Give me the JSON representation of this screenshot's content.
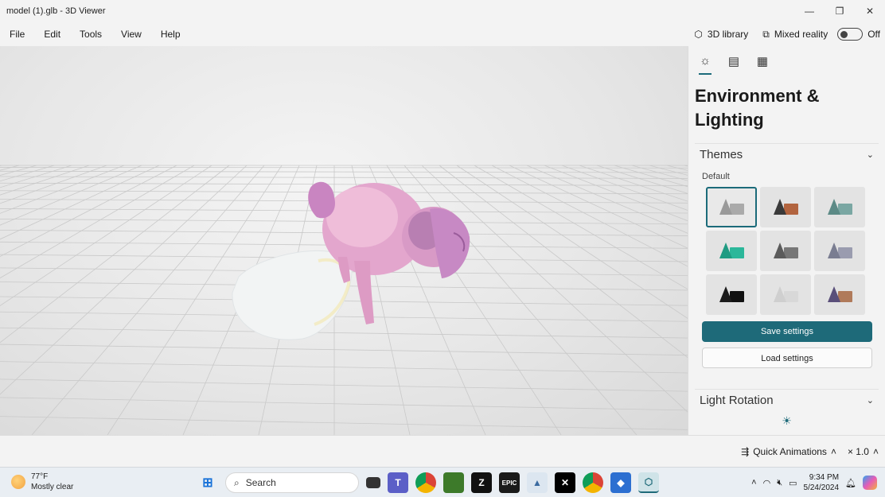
{
  "window": {
    "title": "model (1).glb - 3D Viewer"
  },
  "menu": {
    "items": [
      "File",
      "Edit",
      "Tools",
      "View",
      "Help"
    ],
    "library_label": "3D library",
    "mixed_reality_label": "Mixed reality",
    "mixed_reality_state": "Off"
  },
  "panel": {
    "title_line1": "Environment &",
    "title_line2": "Lighting",
    "themes_label": "Themes",
    "themes_sub": "Default",
    "save_label": "Save settings",
    "load_label": "Load settings",
    "light_rotation_label": "Light Rotation",
    "theme_colors": [
      {
        "cone": "#9a9a9a",
        "box": "#aaaaaa"
      },
      {
        "cone": "#3a3a3a",
        "box": "#b2643f"
      },
      {
        "cone": "#5c8a86",
        "box": "#7aa7a3"
      },
      {
        "cone": "#1f9b82",
        "box": "#2bb79a"
      },
      {
        "cone": "#5b5b5b",
        "box": "#777777"
      },
      {
        "cone": "#7a7d91",
        "box": "#9a9caf"
      },
      {
        "cone": "#1c1c1c",
        "box": "#111111"
      },
      {
        "cone": "#cfcfcf",
        "box": "#d8d8d8"
      },
      {
        "cone": "#5a4f7a",
        "box": "#b07a5a"
      }
    ]
  },
  "bottom": {
    "quick_animations": "Quick Animations",
    "speed": "× 1.0"
  },
  "taskbar": {
    "temperature": "77°F",
    "condition": "Mostly clear",
    "search_placeholder": "Search",
    "time": "9:34 PM",
    "date": "5/24/2024"
  }
}
